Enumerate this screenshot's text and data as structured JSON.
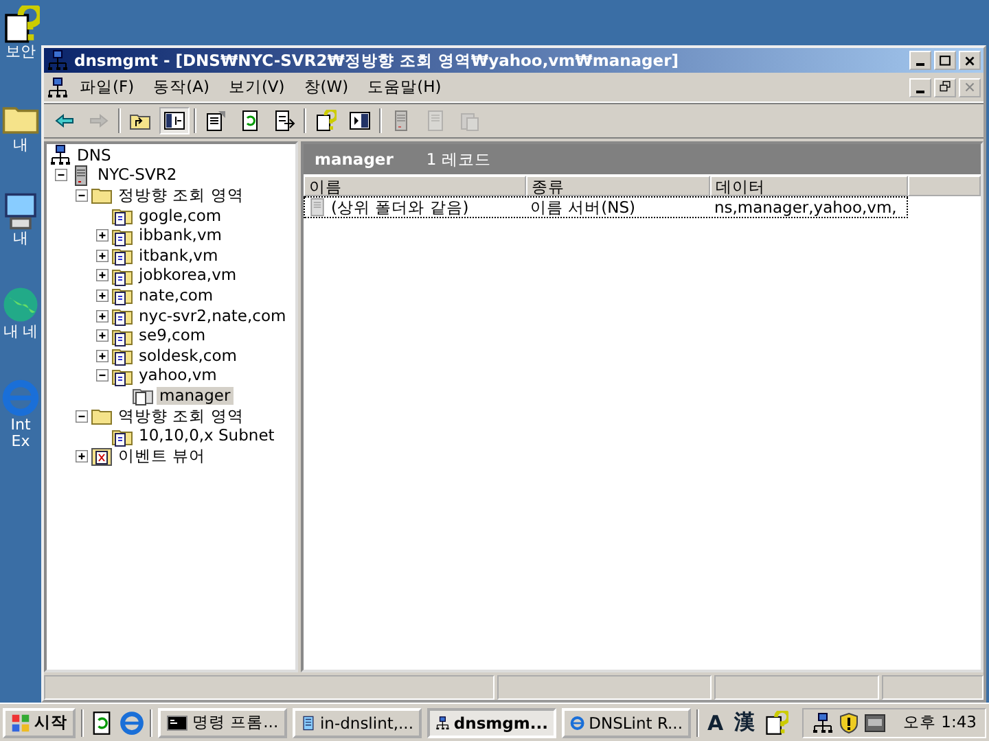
{
  "desktop_icons": [
    {
      "label": "보안",
      "kind": "help"
    },
    {
      "label": "내",
      "kind": "folder"
    },
    {
      "label": "내",
      "kind": "computer"
    },
    {
      "label": "내 네",
      "kind": "globe"
    },
    {
      "label": "Int Ex",
      "kind": "browser"
    }
  ],
  "window": {
    "title": "dnsmgmt - [DNS₩NYC-SVR2₩정방향 조회 영역₩yahoo,vm₩manager]"
  },
  "menu": [
    "파일(F)",
    "동작(A)",
    "보기(V)",
    "창(W)",
    "도움말(H)"
  ],
  "toolbar": [
    {
      "kind": "back",
      "disabled": false,
      "pressed": false
    },
    {
      "kind": "forward",
      "disabled": true,
      "pressed": false
    },
    {
      "kind": "sep"
    },
    {
      "kind": "up",
      "disabled": false,
      "pressed": false
    },
    {
      "kind": "tree",
      "disabled": false,
      "pressed": true
    },
    {
      "kind": "sep"
    },
    {
      "kind": "properties",
      "disabled": false,
      "pressed": false
    },
    {
      "kind": "refresh",
      "disabled": false,
      "pressed": false
    },
    {
      "kind": "export",
      "disabled": false,
      "pressed": false
    },
    {
      "kind": "sep"
    },
    {
      "kind": "help",
      "disabled": false,
      "pressed": false
    },
    {
      "kind": "panel",
      "disabled": false,
      "pressed": false
    },
    {
      "kind": "sep"
    },
    {
      "kind": "server",
      "disabled": true,
      "pressed": false
    },
    {
      "kind": "page",
      "disabled": true,
      "pressed": false
    },
    {
      "kind": "copy",
      "disabled": true,
      "pressed": false
    }
  ],
  "tree": [
    {
      "label": "DNS",
      "kind": "dns",
      "selected": false,
      "children": [
        {
          "label": "NYC-SVR2",
          "kind": "server",
          "expanded": true,
          "selected": false,
          "children": [
            {
              "label": "정방향 조회 영역",
              "kind": "folder",
              "expanded": true,
              "selected": false,
              "children": [
                {
                  "label": "gogle,com",
                  "kind": "zone",
                  "selected": false
                },
                {
                  "label": "ibbank,vm",
                  "kind": "zone",
                  "expanded": false,
                  "selected": false
                },
                {
                  "label": "itbank,vm",
                  "kind": "zone",
                  "expanded": false,
                  "selected": false
                },
                {
                  "label": "jobkorea,vm",
                  "kind": "zone",
                  "expanded": false,
                  "selected": false
                },
                {
                  "label": "nate,com",
                  "kind": "zone",
                  "expanded": false,
                  "selected": false
                },
                {
                  "label": "nyc-svr2,nate,com",
                  "kind": "zone",
                  "expanded": false,
                  "selected": false
                },
                {
                  "label": "se9,com",
                  "kind": "zone",
                  "expanded": false,
                  "selected": false
                },
                {
                  "label": "soldesk,com",
                  "kind": "zone",
                  "expanded": false,
                  "selected": false
                },
                {
                  "label": "yahoo,vm",
                  "kind": "zone",
                  "expanded": true,
                  "selected": false,
                  "children": [
                    {
                      "label": "manager",
                      "kind": "subdomain",
                      "selected": true
                    }
                  ]
                }
              ]
            },
            {
              "label": "역방향 조회 영역",
              "kind": "folder",
              "expanded": true,
              "selected": false,
              "children": [
                {
                  "label": "10,10,0,x Subnet",
                  "kind": "zone",
                  "selected": false
                }
              ]
            },
            {
              "label": "이벤트 뷰어",
              "kind": "events",
              "expanded": false,
              "selected": false
            }
          ]
        }
      ]
    }
  ],
  "details": {
    "title": "manager",
    "count": "1 레코드",
    "columns": [
      "이름",
      "종류",
      "데이터"
    ],
    "rows": [
      {
        "name": "(상위 폴더와 같음)",
        "type": "이름 서버(NS)",
        "data": "ns,manager,yahoo,vm,",
        "focused": true
      }
    ]
  },
  "taskbar": {
    "start": "시작",
    "tasks": [
      {
        "label": "명령 프롬...",
        "kind": "console",
        "selected": false
      },
      {
        "label": "in-dnslint,...",
        "kind": "notepad",
        "selected": false
      },
      {
        "label": "dnsmgm...",
        "kind": "dns",
        "selected": true
      },
      {
        "label": "DNSLint R...",
        "kind": "browser",
        "selected": false
      }
    ],
    "language": [
      "A",
      "漢"
    ],
    "clock": "오후 1:43"
  }
}
